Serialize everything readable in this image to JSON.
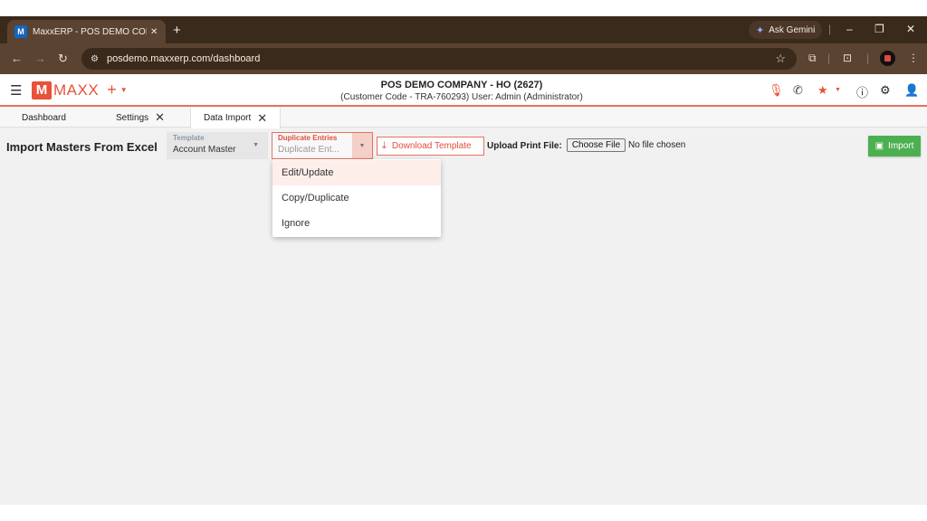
{
  "browser": {
    "tab_title": "MaxxERP - POS DEMO COMPANY",
    "tab_close": "✕",
    "new_tab": "+",
    "favicon_letter": "M",
    "gemini_label": "Ask Gemini",
    "url": "posdemo.maxxerp.com/dashboard",
    "min": "–",
    "restore": "❐",
    "close": "✕"
  },
  "app": {
    "logo_letter": "M",
    "logo_text": "MAXX",
    "company_name": "POS DEMO COMPANY - HO (2627)",
    "company_sub": "(Customer Code - TRA-760293) User: Admin (Administrator)",
    "accent_color": "#e8523a"
  },
  "tabs": [
    {
      "label": "Dashboard"
    },
    {
      "label": "Settings"
    },
    {
      "label": "Data Import"
    }
  ],
  "page": {
    "title": "Import Masters From Excel",
    "template_label": "Template",
    "template_value": "Account Master",
    "duplicate_label": "Duplicate Entries",
    "duplicate_placeholder": "Duplicate Ent...",
    "download_label": "Download Template",
    "upload_label": "Upload Print File:",
    "choose_file": "Choose File",
    "no_file": "No file chosen",
    "import_label": "Import"
  },
  "dropdown": {
    "options": [
      "Edit/Update",
      "Copy/Duplicate",
      "Ignore"
    ],
    "highlighted": "Edit/Update"
  }
}
